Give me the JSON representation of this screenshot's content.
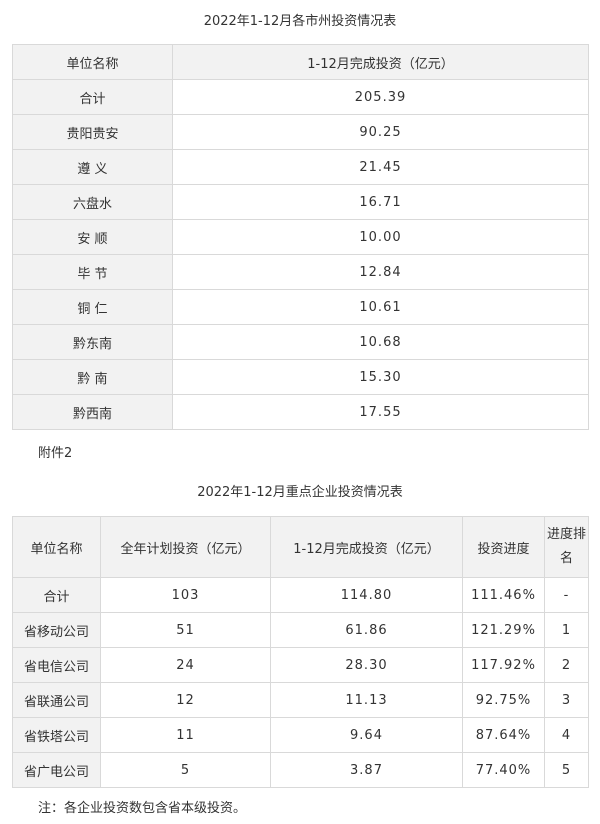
{
  "table1": {
    "title": "2022年1-12月各市州投资情况表",
    "headers": [
      "单位名称",
      "1-12月完成投资（亿元）"
    ],
    "rows": [
      {
        "name": "合计",
        "value": "205.39"
      },
      {
        "name": "贵阳贵安",
        "value": "90.25"
      },
      {
        "name": "遵 义",
        "value": "21.45"
      },
      {
        "name": "六盘水",
        "value": "16.71"
      },
      {
        "name": "安 顺",
        "value": "10.00"
      },
      {
        "name": "毕 节",
        "value": "12.84"
      },
      {
        "name": "铜 仁",
        "value": "10.61"
      },
      {
        "name": "黔东南",
        "value": "10.68"
      },
      {
        "name": "黔 南",
        "value": "15.30"
      },
      {
        "name": "黔西南",
        "value": "17.55"
      }
    ]
  },
  "attachment_label": "附件2",
  "table2": {
    "title": "2022年1-12月重点企业投资情况表",
    "headers": [
      "单位名称",
      "全年计划投资（亿元）",
      "1-12月完成投资（亿元）",
      "投资进度",
      "进度排名"
    ],
    "rows": [
      {
        "name": "合计",
        "plan": "103",
        "done": "114.80",
        "progress": "111.46%",
        "rank": "-"
      },
      {
        "name": "省移动公司",
        "plan": "51",
        "done": "61.86",
        "progress": "121.29%",
        "rank": "1"
      },
      {
        "name": "省电信公司",
        "plan": "24",
        "done": "28.30",
        "progress": "117.92%",
        "rank": "2"
      },
      {
        "name": "省联通公司",
        "plan": "12",
        "done": "11.13",
        "progress": "92.75%",
        "rank": "3"
      },
      {
        "name": "省铁塔公司",
        "plan": "11",
        "done": "9.64",
        "progress": "87.64%",
        "rank": "4"
      },
      {
        "name": "省广电公司",
        "plan": "5",
        "done": "3.87",
        "progress": "77.40%",
        "rank": "5"
      }
    ]
  },
  "note": "注：各企业投资数包含省本级投资。"
}
